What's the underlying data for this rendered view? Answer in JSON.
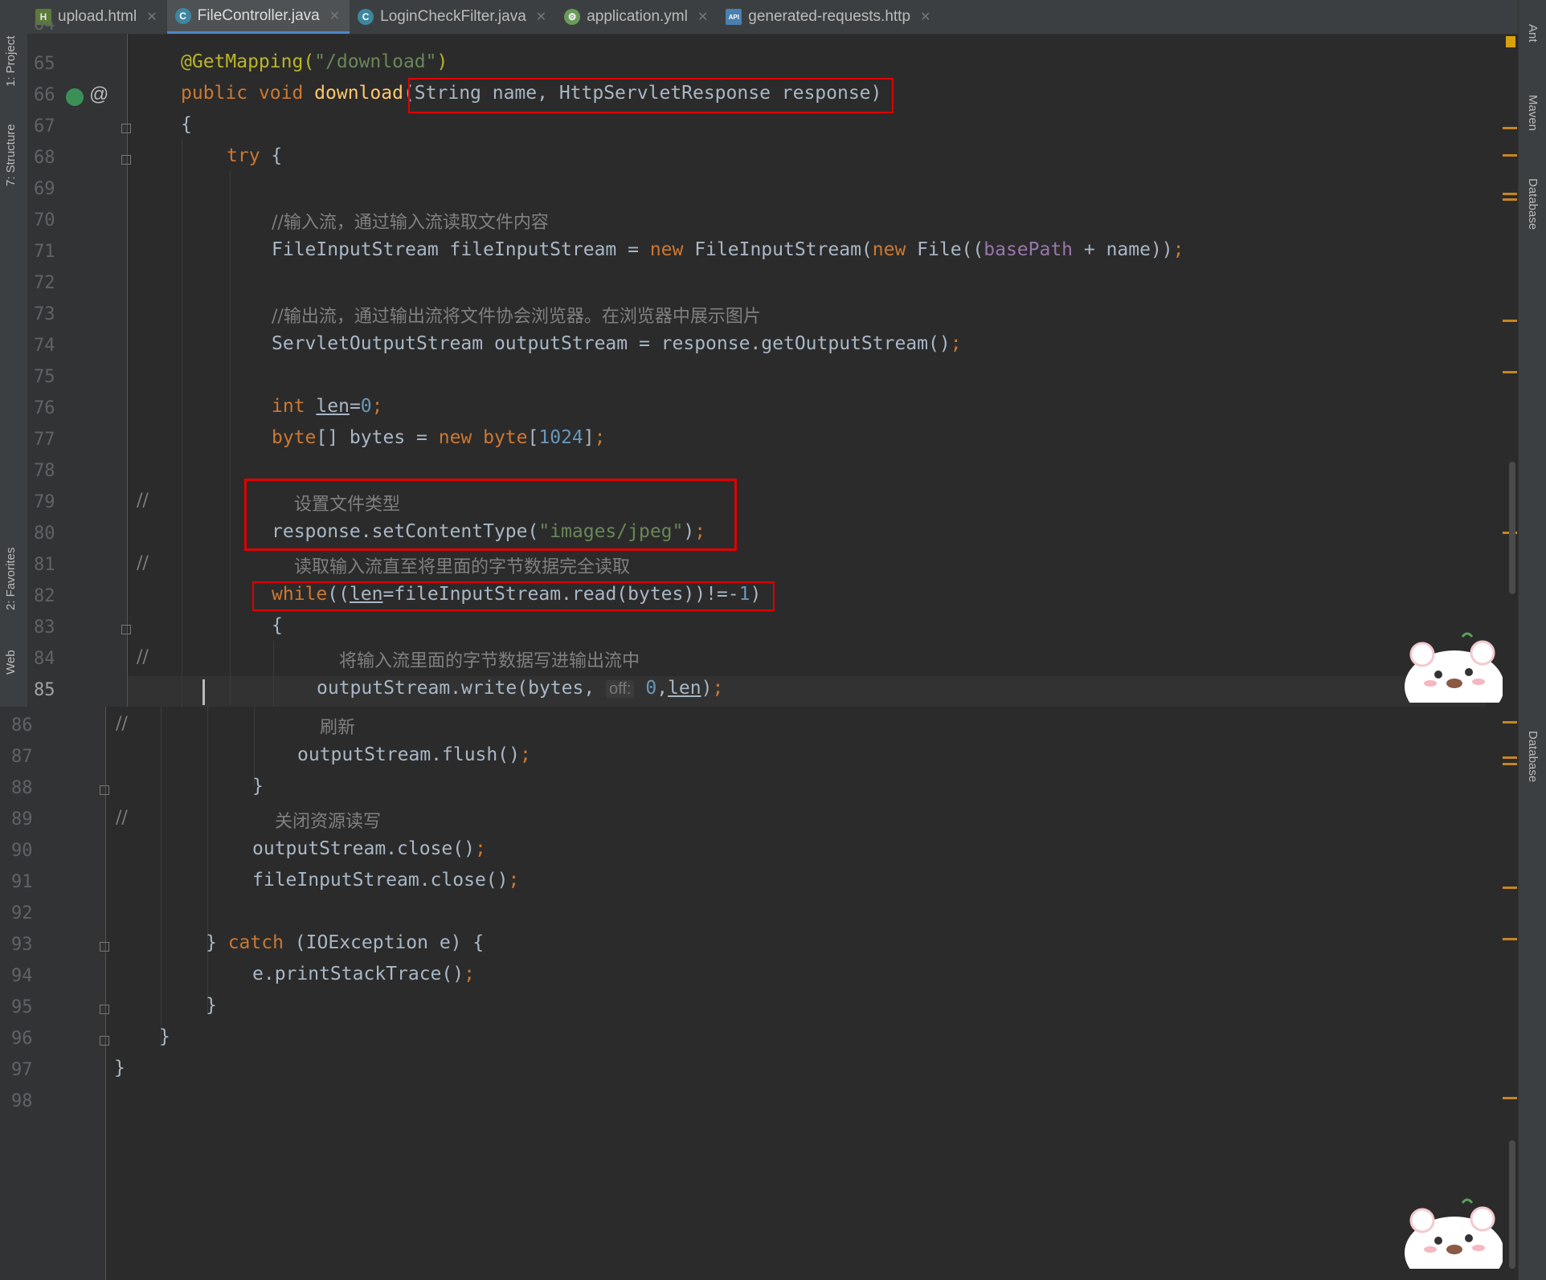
{
  "tabs": [
    {
      "label": "upload.html",
      "icon": "html-file-icon",
      "active": false
    },
    {
      "label": "FileController.java",
      "icon": "java-class-icon",
      "active": true
    },
    {
      "label": "LoginCheckFilter.java",
      "icon": "java-class-icon",
      "active": false
    },
    {
      "label": "application.yml",
      "icon": "yaml-file-icon",
      "active": false
    },
    {
      "label": "generated-requests.http",
      "icon": "http-api-file-icon",
      "active": false
    }
  ],
  "left_tools": {
    "project": "1: Project",
    "structure": "7: Structure",
    "favorites": "2: Favorites",
    "web": "Web"
  },
  "right_tools": {
    "ant": "Ant",
    "maven": "Maven",
    "database": "Database"
  },
  "pane1": {
    "line_numbers": [
      "64",
      "65",
      "66",
      "67",
      "68",
      "69",
      "70",
      "71",
      "72",
      "73",
      "74",
      "75",
      "76",
      "77",
      "78",
      "79",
      "80",
      "81",
      "82",
      "83",
      "84",
      "85"
    ],
    "current_line": "85"
  },
  "pane2": {
    "line_numbers": [
      "86",
      "87",
      "88",
      "89",
      "90",
      "91",
      "92",
      "93",
      "94",
      "95",
      "96",
      "97",
      "98"
    ]
  },
  "code": {
    "l65": {
      "ann": "@GetMapping(",
      "str": "\"/download\"",
      "close": ")"
    },
    "l66": {
      "kw": "public void ",
      "fn": "download",
      "params": "(String name, HttpServletResponse response)"
    },
    "l67": "{",
    "l68": {
      "kw": "try",
      "rest": " {"
    },
    "l70": "//输入流，通过输入流读取文件内容",
    "l71": {
      "a": "FileInputStream fileInputStream = ",
      "kw1": "new",
      "b": " FileInputStream(",
      "kw2": "new",
      "c": " File((",
      "fld": "basePath",
      "d": " + name))",
      "semi": ";"
    },
    "l73": "//输出流，通过输出流将文件协会浏览器。在浏览器中展示图片",
    "l74": {
      "a": "ServletOutputStream outputStream = response.getOutputStream()",
      "semi": ";"
    },
    "l76": {
      "kw": "int ",
      "var": "len",
      "eq": "=",
      "num": "0",
      "semi": ";"
    },
    "l77": {
      "kw1": "byte",
      "a": "[] bytes = ",
      "kw2": "new",
      "kw3": " byte",
      "b": "[",
      "num": "1024",
      "c": "]",
      "semi": ";"
    },
    "l79": {
      "slashes": "//",
      "text": "设置文件类型"
    },
    "l80": {
      "a": "response.setContentType(",
      "str": "\"images/jpeg\"",
      "b": ")",
      "semi": ";"
    },
    "l81": {
      "slashes": "//",
      "text": "读取输入流直至将里面的字节数据完全读取"
    },
    "l82": {
      "kw": "while",
      "a": "((",
      "var": "len",
      "b": "=fileInputStream.read(bytes))!=-",
      "num": "1",
      "c": ")"
    },
    "l83": "{",
    "l84": {
      "slashes": "//",
      "text": "将输入流里面的字节数据写进输出流中"
    },
    "l85": {
      "a": "outputStream.write(bytes, ",
      "hint": "off:",
      "num": "0",
      "b": ",",
      "var": "len",
      "c": ")",
      "semi": ";"
    },
    "l86": {
      "slashes": "//",
      "text": "刷新"
    },
    "l87": {
      "a": "outputStream.flush()",
      "semi": ";"
    },
    "l88": "}",
    "l89": {
      "slashes": "//",
      "text": "关闭资源读写"
    },
    "l90": {
      "a": "outputStream.close()",
      "semi": ";"
    },
    "l91": {
      "a": "fileInputStream.close()",
      "semi": ";"
    },
    "l93": {
      "a": "} ",
      "kw": "catch",
      "b": " (IOException e) {"
    },
    "l94": {
      "a": "e.printStackTrace()",
      "semi": ";"
    },
    "l95": "}",
    "l96": "}",
    "l97": "}"
  },
  "colors": {
    "editor_bg": "#2b2b2b",
    "keyword": "#cc7832",
    "string": "#6a8759",
    "number": "#6897bb",
    "annotation": "#bbb529",
    "method": "#ffc66d",
    "field": "#9876aa",
    "comment": "#808080",
    "highlight_box": "#e00000"
  }
}
